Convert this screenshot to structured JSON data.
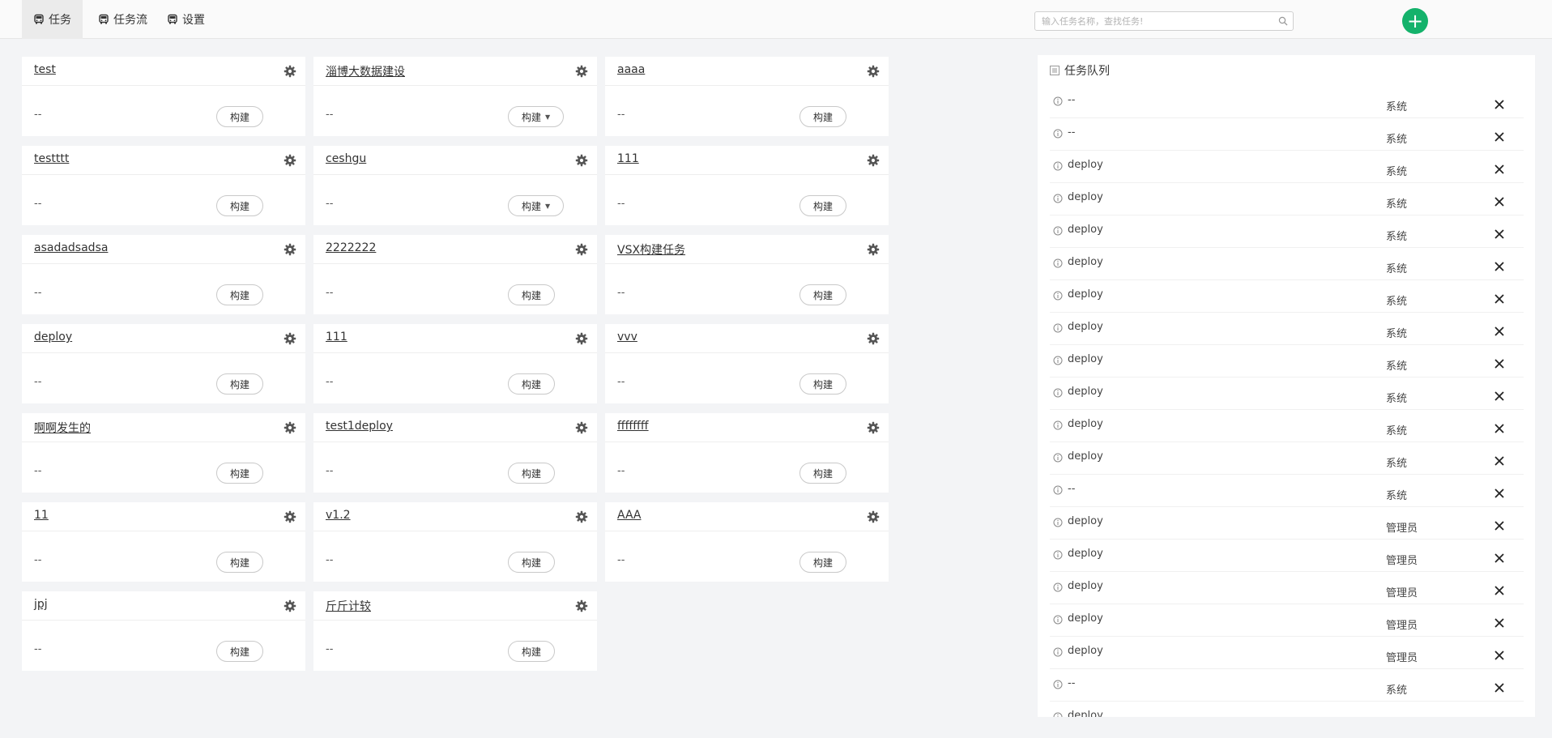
{
  "nav": {
    "tabs": [
      {
        "label": "任务",
        "icon": "bus-icon",
        "active": true
      },
      {
        "label": "任务流",
        "icon": "bus-icon",
        "active": false
      },
      {
        "label": "设置",
        "icon": "bus-icon",
        "active": false
      }
    ]
  },
  "search": {
    "placeholder": "输入任务名称，查找任务!",
    "value": ""
  },
  "add_button": {
    "label": "+"
  },
  "colors": {
    "accent": "#14b26b",
    "background": "#f3f4f6",
    "card": "#ffffff"
  },
  "tasks": [
    {
      "name": "test",
      "status": "--",
      "build_label": "构建",
      "has_dropdown": false
    },
    {
      "name": "淄博大数据建设",
      "status": "--",
      "build_label": "构建",
      "has_dropdown": true
    },
    {
      "name": "aaaa",
      "status": "--",
      "build_label": "构建",
      "has_dropdown": false
    },
    {
      "name": "testttt",
      "status": "--",
      "build_label": "构建",
      "has_dropdown": false
    },
    {
      "name": "ceshgu",
      "status": "--",
      "build_label": "构建",
      "has_dropdown": true
    },
    {
      "name": "111",
      "status": "--",
      "build_label": "构建",
      "has_dropdown": false
    },
    {
      "name": "asadadsadsa",
      "status": "--",
      "build_label": "构建",
      "has_dropdown": false
    },
    {
      "name": "2222222",
      "status": "--",
      "build_label": "构建",
      "has_dropdown": false
    },
    {
      "name": "VSX构建任务",
      "status": "--",
      "build_label": "构建",
      "has_dropdown": false
    },
    {
      "name": "deploy",
      "status": "--",
      "build_label": "构建",
      "has_dropdown": false
    },
    {
      "name": "111",
      "status": "--",
      "build_label": "构建",
      "has_dropdown": false
    },
    {
      "name": "vvv",
      "status": "--",
      "build_label": "构建",
      "has_dropdown": false
    },
    {
      "name": "啊啊发生的",
      "status": "--",
      "build_label": "构建",
      "has_dropdown": false
    },
    {
      "name": "test1deploy",
      "status": "--",
      "build_label": "构建",
      "has_dropdown": false
    },
    {
      "name": "ffffffff",
      "status": "--",
      "build_label": "构建",
      "has_dropdown": false
    },
    {
      "name": "11",
      "status": "--",
      "build_label": "构建",
      "has_dropdown": false
    },
    {
      "name": "v1.2",
      "status": "--",
      "build_label": "构建",
      "has_dropdown": false
    },
    {
      "name": "AAA",
      "status": "--",
      "build_label": "构建",
      "has_dropdown": false
    },
    {
      "name": "jpj",
      "status": "--",
      "build_label": "构建",
      "has_dropdown": false
    },
    {
      "name": "斤斤计较",
      "status": "--",
      "build_label": "构建",
      "has_dropdown": false
    }
  ],
  "queue": {
    "title": "任务队列",
    "items": [
      {
        "name": "--",
        "user": "系统"
      },
      {
        "name": "--",
        "user": "系统"
      },
      {
        "name": "deploy",
        "user": "系统"
      },
      {
        "name": "deploy",
        "user": "系统"
      },
      {
        "name": "deploy",
        "user": "系统"
      },
      {
        "name": "deploy",
        "user": "系统"
      },
      {
        "name": "deploy",
        "user": "系统"
      },
      {
        "name": "deploy",
        "user": "系统"
      },
      {
        "name": "deploy",
        "user": "系统"
      },
      {
        "name": "deploy",
        "user": "系统"
      },
      {
        "name": "deploy",
        "user": "系统"
      },
      {
        "name": "deploy",
        "user": "系统"
      },
      {
        "name": "--",
        "user": "系统"
      },
      {
        "name": "deploy",
        "user": "管理员"
      },
      {
        "name": "deploy",
        "user": "管理员"
      },
      {
        "name": "deploy",
        "user": "管理员"
      },
      {
        "name": "deploy",
        "user": "管理员"
      },
      {
        "name": "deploy",
        "user": "管理员"
      },
      {
        "name": "--",
        "user": "系统"
      },
      {
        "name": "deploy",
        "user": ""
      }
    ]
  }
}
